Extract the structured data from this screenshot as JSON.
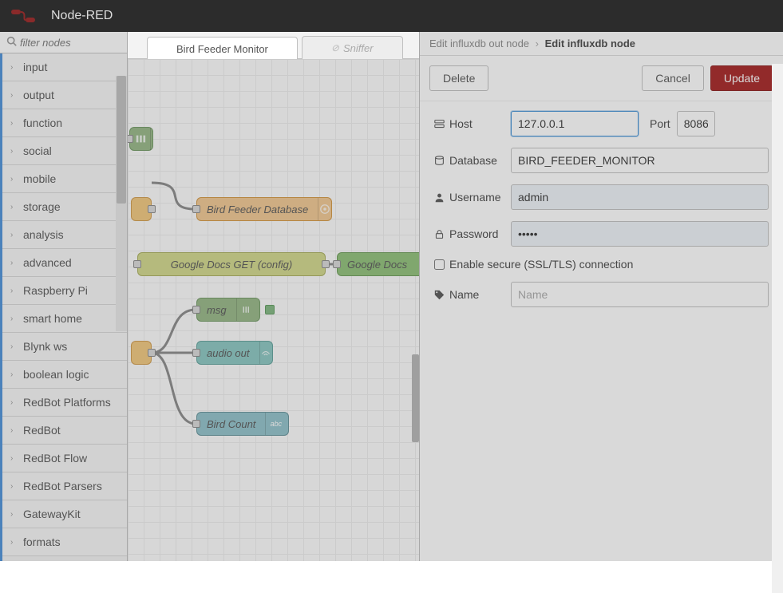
{
  "header": {
    "title": "Node-RED"
  },
  "palette": {
    "filter_placeholder": "filter nodes",
    "categories": [
      "input",
      "output",
      "function",
      "social",
      "mobile",
      "storage",
      "analysis",
      "advanced",
      "Raspberry Pi",
      "smart home",
      "Blynk ws",
      "boolean logic",
      "RedBot Platforms",
      "RedBot",
      "RedBot Flow",
      "RedBot Parsers",
      "GatewayKit",
      "formats"
    ]
  },
  "tabs": {
    "active": "Bird Feeder Monitor",
    "inactive": "Sniffer"
  },
  "nodes": {
    "influx_db": "Bird Feeder Database",
    "gdocs_get": "Google Docs GET (config)",
    "gdocs": "Google Docs",
    "msg": "msg",
    "audio": "audio out",
    "birdcount": "Bird Count"
  },
  "breadcrumb": {
    "prev": "Edit influxdb out node",
    "current": "Edit influxdb node"
  },
  "buttons": {
    "delete": "Delete",
    "cancel": "Cancel",
    "update": "Update"
  },
  "form": {
    "host_label": "Host",
    "host_value": "127.0.0.1",
    "port_label": "Port",
    "port_value": "8086",
    "database_label": "Database",
    "database_value": "BIRD_FEEDER_MONITOR",
    "username_label": "Username",
    "username_value": "admin",
    "password_label": "Password",
    "password_value": "•••••",
    "ssl_label": "Enable secure (SSL/TLS) connection",
    "name_label": "Name",
    "name_placeholder": "Name"
  }
}
